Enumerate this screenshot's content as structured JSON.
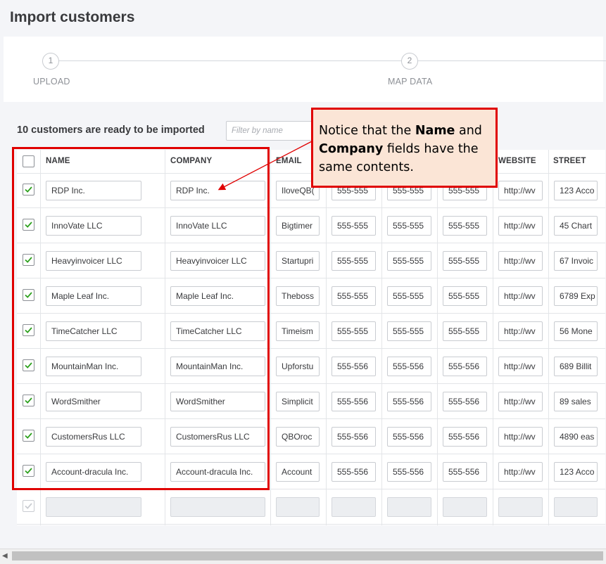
{
  "page": {
    "title": "Import customers"
  },
  "steps": [
    {
      "number": "1",
      "label": "UPLOAD"
    },
    {
      "number": "2",
      "label": "MAP DATA"
    }
  ],
  "summary": {
    "ready_text": "10 customers are ready to be imported"
  },
  "filter": {
    "placeholder": "Filter by name"
  },
  "columns": [
    "NAME",
    "COMPANY",
    "EMAIL",
    "WEBSITE",
    "STREET"
  ],
  "rows": [
    {
      "name": "RDP Inc.",
      "company": "RDP Inc.",
      "email": "IloveQB(",
      "p1": "555-555",
      "p2": "555-555",
      "p3": "555-555",
      "website": "http://wv",
      "street": "123 Acco"
    },
    {
      "name": "InnoVate LLC",
      "company": "InnoVate LLC",
      "email": "Bigtimer",
      "p1": "555-555",
      "p2": "555-555",
      "p3": "555-555",
      "website": "http://wv",
      "street": "45 Chart"
    },
    {
      "name": "Heavyinvoicer LLC",
      "company": "Heavyinvoicer LLC",
      "email": "Startupri",
      "p1": "555-555",
      "p2": "555-555",
      "p3": "555-555",
      "website": "http://wv",
      "street": "67 Invoic"
    },
    {
      "name": "Maple Leaf Inc.",
      "company": "Maple Leaf Inc.",
      "email": "Theboss",
      "p1": "555-555",
      "p2": "555-555",
      "p3": "555-555",
      "website": "http://wv",
      "street": "6789 Exp"
    },
    {
      "name": "TimeCatcher LLC",
      "company": "TimeCatcher LLC",
      "email": "Timeism",
      "p1": "555-555",
      "p2": "555-555",
      "p3": "555-555",
      "website": "http://wv",
      "street": "56 Mone"
    },
    {
      "name": "MountainMan Inc.",
      "company": "MountainMan Inc.",
      "email": "Upforstu",
      "p1": "555-556",
      "p2": "555-556",
      "p3": "555-556",
      "website": "http://wv",
      "street": "689 Billit"
    },
    {
      "name": "WordSmither",
      "company": "WordSmither",
      "email": "Simplicit",
      "p1": "555-556",
      "p2": "555-556",
      "p3": "555-556",
      "website": "http://wv",
      "street": "89 sales"
    },
    {
      "name": "CustomersRus LLC",
      "company": "CustomersRus LLC",
      "email": "QBOroc",
      "p1": "555-556",
      "p2": "555-556",
      "p3": "555-556",
      "website": "http://wv",
      "street": "4890 eas"
    },
    {
      "name": "Account-dracula Inc.",
      "company": "Account-dracula Inc.",
      "email": "Account",
      "p1": "555-556",
      "p2": "555-556",
      "p3": "555-556",
      "website": "http://wv",
      "street": "123 Acco"
    }
  ],
  "callout": {
    "part1": "Notice that the ",
    "bold1": "Name",
    "part2": " and ",
    "bold2": "Company",
    "part3": " fields have the same contents."
  },
  "colors": {
    "highlight": "#e00000",
    "callout_bg": "#fbe5d6",
    "check": "#2ca01c"
  }
}
